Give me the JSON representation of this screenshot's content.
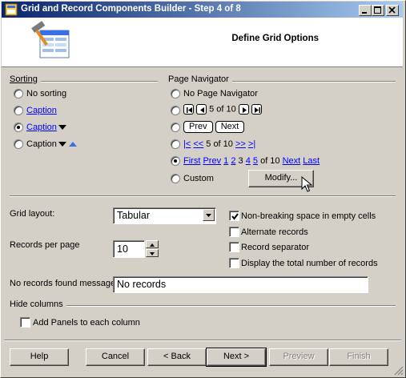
{
  "window": {
    "title": "Grid and Record Components Builder - Step 4 of 8",
    "header_title": "Define Grid Options"
  },
  "sorting": {
    "label": "Sorting",
    "options": {
      "none": "No sorting",
      "caption_link": "Caption",
      "caption_arrow": "Caption",
      "caption_both": "Caption"
    },
    "selected": "caption_arrow"
  },
  "navigator": {
    "label": "Page Navigator",
    "no_nav": "No Page Navigator",
    "icons_text": "5 of 10",
    "prev": "Prev",
    "next": "Next",
    "links_first": "|<",
    "links_prev": "<<",
    "links_text": "5 of 10",
    "links_next": ">>",
    "links_last": ">|",
    "full_first": "First",
    "full_prev": "Prev",
    "full_p1": "1",
    "full_p2": "2",
    "full_p3": "3",
    "full_p4": "4",
    "full_p5": "5",
    "full_of": "of 10",
    "full_next": "Next",
    "full_last": "Last",
    "custom": "Custom",
    "modify": "Modify...",
    "selected": "full"
  },
  "grid": {
    "layout_label": "Grid layout:",
    "layout_value": "Tabular",
    "records_label": "Records per page",
    "records_value": "10",
    "no_records_label": "No records found message",
    "no_records_value": "No records"
  },
  "checks": {
    "nbsp": {
      "label": "Non-breaking space in empty cells",
      "checked": true
    },
    "alternate": {
      "label": "Alternate records",
      "checked": false
    },
    "separator": {
      "label": "Record separator",
      "checked": false
    },
    "total": {
      "label": "Display the total number of records",
      "checked": false
    }
  },
  "hide_columns": {
    "label": "Hide columns",
    "add_panels": "Add Panels to each column",
    "checked": false
  },
  "buttons": {
    "help": "Help",
    "cancel": "Cancel",
    "back": "< Back",
    "next": "Next >",
    "preview": "Preview",
    "finish": "Finish"
  }
}
